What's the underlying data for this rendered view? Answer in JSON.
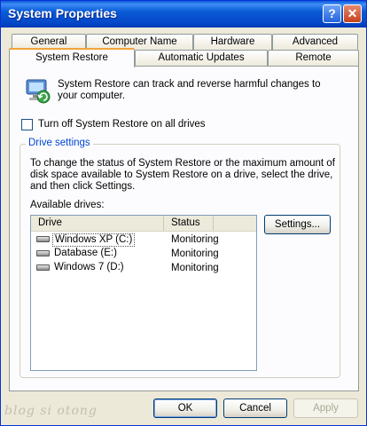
{
  "window": {
    "title": "System Properties"
  },
  "titlebar": {
    "help_glyph": "?",
    "close_glyph": "✕"
  },
  "tabs_row1": [
    {
      "label": "General"
    },
    {
      "label": "Computer Name"
    },
    {
      "label": "Hardware"
    },
    {
      "label": "Advanced"
    }
  ],
  "tabs_row2": [
    {
      "label": "System Restore",
      "active": true
    },
    {
      "label": "Automatic Updates"
    },
    {
      "label": "Remote"
    }
  ],
  "info": {
    "icon": "system-restore-icon",
    "text": "System Restore can track and reverse harmful changes to your computer."
  },
  "checkbox": {
    "label": "Turn off System Restore on all drives",
    "checked": false
  },
  "drive_settings": {
    "group_label": "Drive settings",
    "description": "To change the status of System Restore or the maximum amount of disk space available to System Restore on a drive, select the drive, and then click Settings.",
    "available_label": "Available drives:",
    "columns": [
      "Drive",
      "Status"
    ],
    "drives": [
      {
        "name": "Windows XP (C:)",
        "status": "Monitoring",
        "selected": true
      },
      {
        "name": "Database (E:)",
        "status": "Monitoring"
      },
      {
        "name": "Windows 7 (D:)",
        "status": "Monitoring"
      }
    ],
    "settings_button": "Settings..."
  },
  "buttons": {
    "ok": "OK",
    "cancel": "Cancel",
    "apply": "Apply"
  },
  "watermark": "blog si otong",
  "colors": {
    "title_bar": "#0a5ad6",
    "group_label": "#0046d5",
    "active_tab_accent": "#f2a43a"
  }
}
